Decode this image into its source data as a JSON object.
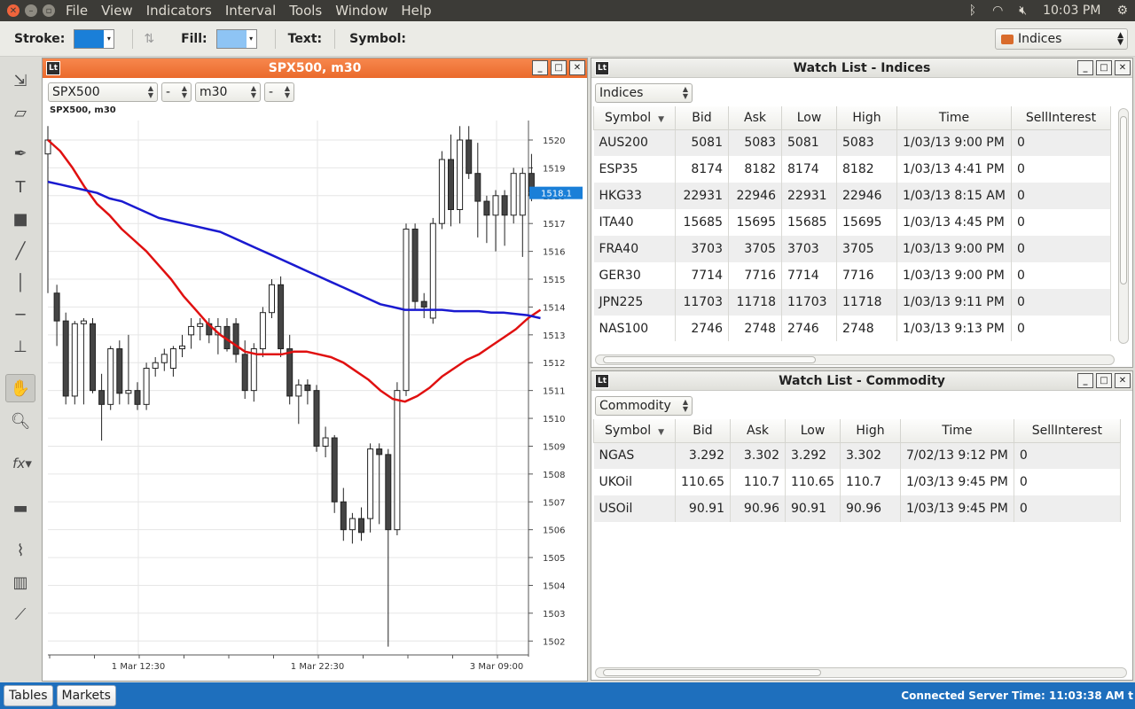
{
  "system": {
    "menus": [
      "File",
      "View",
      "Indicators",
      "Interval",
      "Tools",
      "Window",
      "Help"
    ],
    "clock": "10:03 PM"
  },
  "toolbar": {
    "stroke_label": "Stroke:",
    "fill_label": "Fill:",
    "text_label": "Text:",
    "symbol_label": "Symbol:",
    "stroke_color": "#1a7fd8",
    "fill_color": "#8ec4f4",
    "group_select": "Indices"
  },
  "tools": [
    "select-cursor",
    "eraser",
    "pen",
    "text",
    "rectangle",
    "diagonal-line",
    "vertical-line",
    "horizontal-line",
    "stamp",
    "hand",
    "zoom",
    "function",
    "panel",
    "chart-type-1",
    "chart-type-2",
    "chart-type-3"
  ],
  "chart_window": {
    "title": "SPX500, m30",
    "symbol_combo": "SPX500",
    "mid_combo": "-",
    "interval_combo": "m30",
    "right_combo": "-",
    "caption": "SPX500, m30"
  },
  "chart_data": {
    "type": "candlestick",
    "x_tick_labels": [
      "1 Mar 12:30",
      "1 Mar 22:30",
      "3 Mar 09:00"
    ],
    "y_ticks": [
      1502,
      1503,
      1504,
      1505,
      1506,
      1507,
      1508,
      1509,
      1510,
      1511,
      1512,
      1513,
      1514,
      1515,
      1516,
      1517,
      1518,
      1519,
      1520
    ],
    "ylim": [
      1501.5,
      1520.7
    ],
    "current_price_label": "1518.1",
    "current_price": 1518.1,
    "candles": [
      {
        "o": 1519.5,
        "h": 1520.5,
        "l": 1514.5,
        "c": 1520.0
      },
      {
        "o": 1514.5,
        "h": 1514.8,
        "l": 1512.6,
        "c": 1513.5
      },
      {
        "o": 1513.5,
        "h": 1513.8,
        "l": 1510.5,
        "c": 1510.8
      },
      {
        "o": 1510.8,
        "h": 1513.5,
        "l": 1510.5,
        "c": 1513.4
      },
      {
        "o": 1513.4,
        "h": 1513.6,
        "l": 1510.5,
        "c": 1513.5
      },
      {
        "o": 1513.4,
        "h": 1513.6,
        "l": 1510.9,
        "c": 1511.0
      },
      {
        "o": 1511.0,
        "h": 1511.6,
        "l": 1509.2,
        "c": 1510.5
      },
      {
        "o": 1510.5,
        "h": 1512.6,
        "l": 1510.3,
        "c": 1512.5
      },
      {
        "o": 1512.5,
        "h": 1512.8,
        "l": 1510.5,
        "c": 1510.9
      },
      {
        "o": 1510.9,
        "h": 1513.0,
        "l": 1510.5,
        "c": 1511.0
      },
      {
        "o": 1511.0,
        "h": 1511.3,
        "l": 1510.3,
        "c": 1510.5
      },
      {
        "o": 1510.5,
        "h": 1512.0,
        "l": 1510.3,
        "c": 1511.8
      },
      {
        "o": 1511.8,
        "h": 1512.2,
        "l": 1511.5,
        "c": 1512.0
      },
      {
        "o": 1512.0,
        "h": 1512.5,
        "l": 1511.7,
        "c": 1512.3
      },
      {
        "o": 1511.8,
        "h": 1512.6,
        "l": 1511.5,
        "c": 1512.5
      },
      {
        "o": 1512.5,
        "h": 1513.0,
        "l": 1512.2,
        "c": 1512.6
      },
      {
        "o": 1513.0,
        "h": 1513.6,
        "l": 1512.5,
        "c": 1513.3
      },
      {
        "o": 1513.3,
        "h": 1513.6,
        "l": 1512.8,
        "c": 1513.4
      },
      {
        "o": 1513.4,
        "h": 1513.6,
        "l": 1512.7,
        "c": 1513.0
      },
      {
        "o": 1513.0,
        "h": 1513.6,
        "l": 1512.3,
        "c": 1513.3
      },
      {
        "o": 1513.3,
        "h": 1513.6,
        "l": 1512.4,
        "c": 1512.5
      },
      {
        "o": 1513.4,
        "h": 1513.6,
        "l": 1512.0,
        "c": 1512.3
      },
      {
        "o": 1512.3,
        "h": 1512.8,
        "l": 1510.7,
        "c": 1511.0
      },
      {
        "o": 1511.0,
        "h": 1512.7,
        "l": 1510.6,
        "c": 1512.5
      },
      {
        "o": 1512.5,
        "h": 1514.0,
        "l": 1512.2,
        "c": 1513.8
      },
      {
        "o": 1513.8,
        "h": 1515.0,
        "l": 1513.6,
        "c": 1514.8
      },
      {
        "o": 1514.8,
        "h": 1515.1,
        "l": 1512.2,
        "c": 1512.5
      },
      {
        "o": 1512.5,
        "h": 1513.0,
        "l": 1510.5,
        "c": 1510.8
      },
      {
        "o": 1510.8,
        "h": 1511.4,
        "l": 1509.8,
        "c": 1511.2
      },
      {
        "o": 1511.2,
        "h": 1511.4,
        "l": 1510.5,
        "c": 1511.0
      },
      {
        "o": 1511.0,
        "h": 1511.2,
        "l": 1508.8,
        "c": 1509.0
      },
      {
        "o": 1509.0,
        "h": 1509.7,
        "l": 1508.6,
        "c": 1509.3
      },
      {
        "o": 1509.3,
        "h": 1509.4,
        "l": 1506.6,
        "c": 1507.0
      },
      {
        "o": 1507.0,
        "h": 1507.5,
        "l": 1505.6,
        "c": 1506.0
      },
      {
        "o": 1506.0,
        "h": 1506.6,
        "l": 1505.5,
        "c": 1506.4
      },
      {
        "o": 1506.4,
        "h": 1506.8,
        "l": 1505.6,
        "c": 1505.9
      },
      {
        "o": 1506.4,
        "h": 1509.1,
        "l": 1505.9,
        "c": 1508.9
      },
      {
        "o": 1508.9,
        "h": 1509.1,
        "l": 1506.2,
        "c": 1508.7
      },
      {
        "o": 1508.7,
        "h": 1508.9,
        "l": 1501.8,
        "c": 1506.0
      },
      {
        "o": 1506.0,
        "h": 1511.3,
        "l": 1505.8,
        "c": 1511.0
      },
      {
        "o": 1511.0,
        "h": 1517.0,
        "l": 1510.8,
        "c": 1516.8
      },
      {
        "o": 1516.8,
        "h": 1517.0,
        "l": 1513.9,
        "c": 1514.2
      },
      {
        "o": 1514.2,
        "h": 1514.5,
        "l": 1513.6,
        "c": 1514.0
      },
      {
        "o": 1513.6,
        "h": 1517.2,
        "l": 1513.4,
        "c": 1517.0
      },
      {
        "o": 1517.0,
        "h": 1519.6,
        "l": 1516.8,
        "c": 1519.3
      },
      {
        "o": 1519.3,
        "h": 1520.2,
        "l": 1516.9,
        "c": 1517.5
      },
      {
        "o": 1517.5,
        "h": 1520.5,
        "l": 1517.0,
        "c": 1520.0
      },
      {
        "o": 1520.0,
        "h": 1520.5,
        "l": 1518.6,
        "c": 1518.8
      },
      {
        "o": 1518.8,
        "h": 1519.9,
        "l": 1516.5,
        "c": 1517.8
      },
      {
        "o": 1517.8,
        "h": 1518.0,
        "l": 1516.3,
        "c": 1517.3
      },
      {
        "o": 1517.3,
        "h": 1518.2,
        "l": 1516.0,
        "c": 1518.0
      },
      {
        "o": 1518.0,
        "h": 1518.2,
        "l": 1516.2,
        "c": 1517.3
      },
      {
        "o": 1517.3,
        "h": 1519.0,
        "l": 1517.0,
        "c": 1518.8
      },
      {
        "o": 1517.3,
        "h": 1519.0,
        "l": 1515.8,
        "c": 1518.8
      },
      {
        "o": 1518.8,
        "h": 1519.5,
        "l": 1517.8,
        "c": 1518.0
      },
      {
        "o": 1518.0,
        "h": 1518.3,
        "l": 1517.9,
        "c": 1518.1
      }
    ],
    "series": [
      {
        "color": "#e01010",
        "values": [
          1520.0,
          1519.6,
          1519.0,
          1518.3,
          1517.7,
          1517.3,
          1516.8,
          1516.4,
          1516.0,
          1515.5,
          1515.0,
          1514.4,
          1513.9,
          1513.4,
          1513.0,
          1512.7,
          1512.4,
          1512.3,
          1512.3,
          1512.3,
          1512.4,
          1512.4,
          1512.3,
          1512.2,
          1512.0,
          1511.7,
          1511.4,
          1511.0,
          1510.7,
          1510.6,
          1510.8,
          1511.1,
          1511.5,
          1511.8,
          1512.1,
          1512.3,
          1512.6,
          1512.9,
          1513.2,
          1513.6,
          1513.9
        ]
      },
      {
        "color": "#1a1ad0",
        "values": [
          1518.5,
          1518.4,
          1518.3,
          1518.2,
          1518.1,
          1517.9,
          1517.8,
          1517.6,
          1517.4,
          1517.2,
          1517.1,
          1517.0,
          1516.9,
          1516.8,
          1516.7,
          1516.5,
          1516.3,
          1516.1,
          1515.9,
          1515.7,
          1515.5,
          1515.3,
          1515.1,
          1514.9,
          1514.7,
          1514.5,
          1514.3,
          1514.1,
          1514.0,
          1513.9,
          1513.9,
          1513.9,
          1513.9,
          1513.85,
          1513.85,
          1513.85,
          1513.8,
          1513.8,
          1513.75,
          1513.7,
          1513.6
        ]
      }
    ]
  },
  "watch_indices": {
    "title": "Watch List - Indices",
    "combo": "Indices",
    "columns": [
      "Symbol",
      "Bid",
      "Ask",
      "Low",
      "High",
      "Time",
      "SellInterest"
    ],
    "rows": [
      [
        "AUS200",
        "5081",
        "5083",
        "5081",
        "5083",
        "1/03/13 9:00 PM",
        "0"
      ],
      [
        "ESP35",
        "8174",
        "8182",
        "8174",
        "8182",
        "1/03/13 4:41 PM",
        "0"
      ],
      [
        "HKG33",
        "22931",
        "22946",
        "22931",
        "22946",
        "1/03/13 8:15 AM",
        "0"
      ],
      [
        "ITA40",
        "15685",
        "15695",
        "15685",
        "15695",
        "1/03/13 4:45 PM",
        "0"
      ],
      [
        "FRA40",
        "3703",
        "3705",
        "3703",
        "3705",
        "1/03/13 9:00 PM",
        "0"
      ],
      [
        "GER30",
        "7714",
        "7716",
        "7714",
        "7716",
        "1/03/13 9:00 PM",
        "0"
      ],
      [
        "JPN225",
        "11703",
        "11718",
        "11703",
        "11718",
        "1/03/13 9:11 PM",
        "0"
      ],
      [
        "NAS100",
        "2746",
        "2748",
        "2746",
        "2748",
        "1/03/13 9:13 PM",
        "0"
      ]
    ]
  },
  "watch_commodity": {
    "title": "Watch List - Commodity",
    "combo": "Commodity",
    "columns": [
      "Symbol",
      "Bid",
      "Ask",
      "Low",
      "High",
      "Time",
      "SellInterest"
    ],
    "rows": [
      [
        "NGAS",
        "3.292",
        "3.302",
        "3.292",
        "3.302",
        "7/02/13 9:12 PM",
        "0"
      ],
      [
        "UKOil",
        "110.65",
        "110.7",
        "110.65",
        "110.7",
        "1/03/13 9:45 PM",
        "0"
      ],
      [
        "USOil",
        "90.91",
        "90.96",
        "90.91",
        "90.96",
        "1/03/13 9:45 PM",
        "0"
      ]
    ]
  },
  "statusbar": {
    "tables_button": "Tables",
    "markets_button": "Markets",
    "status": "Connected  Server Time: 11:03:38 AM t"
  }
}
